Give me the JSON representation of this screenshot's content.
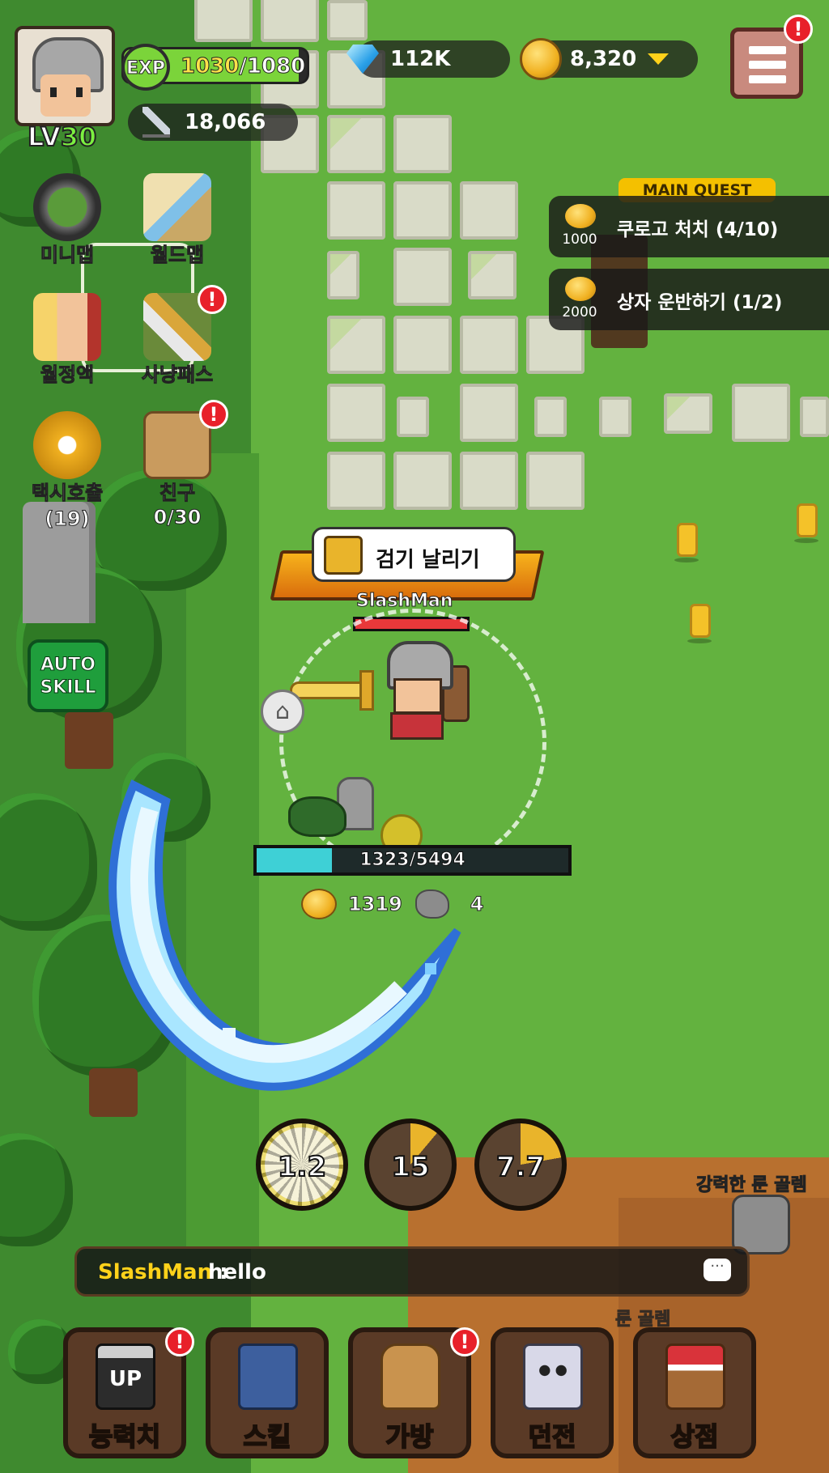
{
  "player": {
    "level_prefix": "LV",
    "level": "30",
    "name": "SlashMan"
  },
  "exp": {
    "label": "EXP",
    "current": "1030",
    "max": "/1080",
    "fraction": 0.954
  },
  "currency": {
    "gems": "112K",
    "gold": "8,320"
  },
  "combat_power": "18,066",
  "side_menu": {
    "minimap": "미니맵",
    "worldmap": "월드맵",
    "moon_potion": "월정액",
    "hunting_pass": "사냥패스",
    "taxi_line1": "택시호출",
    "taxi_line2": "(19)",
    "friends": "친구 0/30",
    "auto_skill_line1": "AUTO",
    "auto_skill_line2": "SKILL"
  },
  "quests": {
    "header": "MAIN QUEST",
    "items": [
      {
        "reward": "1000",
        "text": "쿠로고 처치 (4/10)"
      },
      {
        "reward": "2000",
        "text": "상자 운반하기 (1/2)"
      }
    ]
  },
  "skill_popup": "검기 날리기",
  "monster": {
    "hp_text": "1323/5494",
    "hp_fraction": 0.241,
    "gold_drop": "1319",
    "ore_drop": "4"
  },
  "skills": [
    {
      "cooldown": "1.2",
      "active": true
    },
    {
      "cooldown": "15",
      "active": false
    },
    {
      "cooldown": "7.7",
      "active": false
    }
  ],
  "enemies": {
    "name_prefix": "강력한",
    "name_rest": " 룬 골렘",
    "name2": "룬 골렘"
  },
  "chat": {
    "sender": "SlashMan",
    "separator": " : ",
    "message": "hello"
  },
  "bottom_nav": {
    "stats": "능력치",
    "stats_icon_label": "UP",
    "skills": "스킬",
    "bag": "가방",
    "dungeon": "던전",
    "shop": "상점"
  },
  "alert_mark": "!",
  "colors": {
    "exp_fill": "#7bd43a",
    "monster_hp": "#3ed0d6",
    "player_hp": "#e8383a",
    "gold": "#f0b020",
    "quest_header": "#f4c000"
  },
  "icons": [
    "gem-icon",
    "coin-icon",
    "sword-icon",
    "menu-icon",
    "home-icon",
    "chat-bubble-icon"
  ]
}
